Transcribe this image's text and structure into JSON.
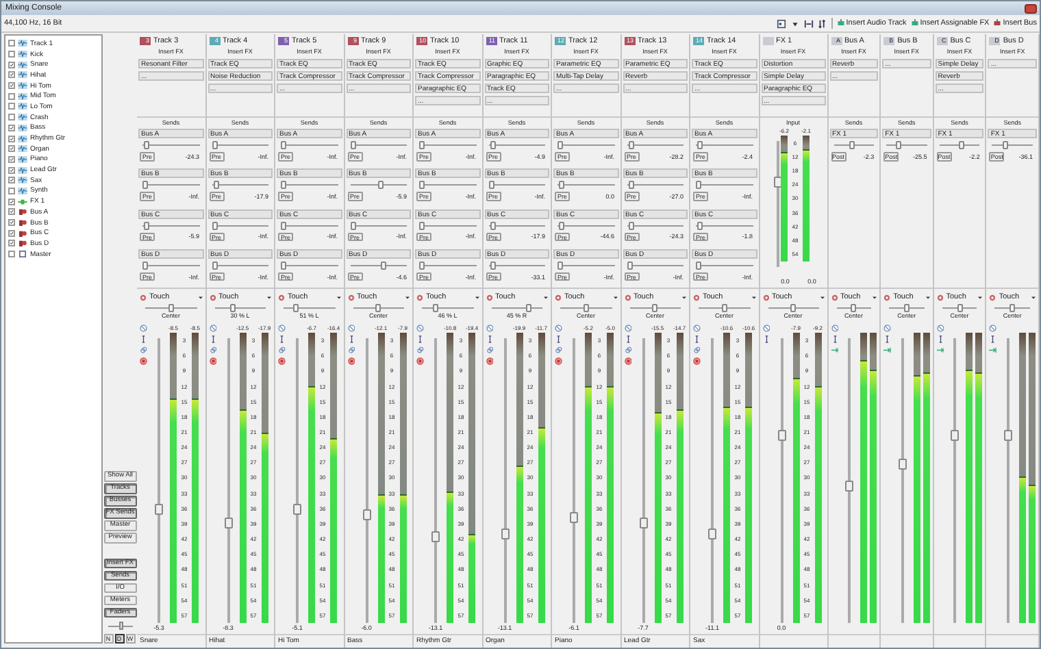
{
  "window": {
    "title": "Mixing Console"
  },
  "format": "44,100 Hz, 16 Bit",
  "toolbar": {
    "buttons": [
      "Insert Audio Track",
      "Insert Assignable FX",
      "Insert Bus"
    ]
  },
  "channel_list": [
    {
      "name": "Track 1",
      "kind": "track",
      "checked": false
    },
    {
      "name": "Kick",
      "kind": "track",
      "checked": false
    },
    {
      "name": "Snare",
      "kind": "track",
      "checked": true
    },
    {
      "name": "Hihat",
      "kind": "track",
      "checked": true
    },
    {
      "name": "Hi Tom",
      "kind": "track",
      "checked": true
    },
    {
      "name": "Mid Tom",
      "kind": "track",
      "checked": false
    },
    {
      "name": "Lo Tom",
      "kind": "track",
      "checked": false
    },
    {
      "name": "Crash",
      "kind": "track",
      "checked": false
    },
    {
      "name": "Bass",
      "kind": "track",
      "checked": true
    },
    {
      "name": "Rhythm Gtr",
      "kind": "track",
      "checked": true
    },
    {
      "name": "Organ",
      "kind": "track",
      "checked": true
    },
    {
      "name": "Piano",
      "kind": "track",
      "checked": true
    },
    {
      "name": "Lead Gtr",
      "kind": "track",
      "checked": true
    },
    {
      "name": "Sax",
      "kind": "track",
      "checked": true
    },
    {
      "name": "Synth",
      "kind": "track",
      "checked": false
    },
    {
      "name": "FX 1",
      "kind": "fx",
      "checked": true
    },
    {
      "name": "Bus A",
      "kind": "bus",
      "checked": true
    },
    {
      "name": "Bus B",
      "kind": "bus",
      "checked": true
    },
    {
      "name": "Bus C",
      "kind": "bus",
      "checked": true
    },
    {
      "name": "Bus D",
      "kind": "bus",
      "checked": true
    },
    {
      "name": "Master",
      "kind": "master",
      "checked": false
    }
  ],
  "view_buttons": [
    {
      "label": "Show All",
      "checked": false
    },
    {
      "label": "Tracks",
      "checked": true
    },
    {
      "label": "Busses",
      "checked": true
    },
    {
      "label": "FX Sends",
      "checked": true
    },
    {
      "label": "Master",
      "checked": false
    },
    {
      "label": "Preview",
      "checked": false
    }
  ],
  "section_buttons": [
    {
      "label": "Insert FX",
      "checked": true
    },
    {
      "label": "Sends",
      "checked": true
    },
    {
      "label": "I/O",
      "checked": false
    },
    {
      "label": "Meters",
      "checked": false
    },
    {
      "label": "Faders",
      "checked": true
    }
  ],
  "width_slider": {
    "level": 0.55
  },
  "mode_buttons": [
    {
      "label": "N",
      "selected": false
    },
    {
      "label": "D",
      "selected": true
    },
    {
      "label": "W",
      "selected": false
    }
  ],
  "strips": [
    {
      "kind": "track",
      "badge": "3",
      "color": "#b0505e",
      "name": "Track 3",
      "insert_label": "Insert FX",
      "inserts": [
        "Resonant Filter",
        "..."
      ],
      "sends_label": "Sends",
      "sends": [
        {
          "bus": "Bus A",
          "level": 0.03,
          "mode": "Pre",
          "reading": "-24.3"
        },
        {
          "bus": "Bus B",
          "level": 0,
          "mode": "Pre",
          "reading": "-Inf."
        },
        {
          "bus": "Bus C",
          "level": 0.03,
          "mode": "Pre",
          "reading": "-5.9"
        },
        {
          "bus": "Bus D",
          "level": 0,
          "mode": "Pre",
          "reading": "-Inf."
        }
      ],
      "automation": "Touch",
      "pan": {
        "level": 0.5,
        "label": "Center"
      },
      "peaks": [
        "-8.5",
        "-8.5"
      ],
      "meters": [
        {
          "level": 0.77
        },
        {
          "level": 0.77
        }
      ],
      "scale": [
        "3",
        "6",
        "9",
        "12",
        "15",
        "18",
        "21",
        "24",
        "27",
        "30",
        "33",
        "36",
        "39",
        "42",
        "45",
        "48",
        "51",
        "54",
        "57"
      ],
      "fader": {
        "level": 0.4,
        "reading": "-5.3"
      },
      "footer": "Snare"
    },
    {
      "kind": "track",
      "badge": "4",
      "color": "#5eaab6",
      "name": "Track 4",
      "insert_label": "Insert FX",
      "inserts": [
        "Track EQ",
        "Noise Reduction",
        "..."
      ],
      "sends_label": "Sends",
      "sends": [
        {
          "bus": "Bus A",
          "level": 0,
          "mode": "Pre",
          "reading": "-Inf."
        },
        {
          "bus": "Bus B",
          "level": 0.03,
          "mode": "Pre",
          "reading": "-17.9"
        },
        {
          "bus": "Bus C",
          "level": 0,
          "mode": "Pre",
          "reading": "-Inf."
        },
        {
          "bus": "Bus D",
          "level": 0,
          "mode": "Pre",
          "reading": "-Inf."
        }
      ],
      "automation": "Touch",
      "pan": {
        "level": 0.35,
        "label": "30 % L"
      },
      "peaks": [
        "-12.5",
        "-17.9"
      ],
      "meters": [
        {
          "level": 0.73
        },
        {
          "level": 0.65
        }
      ],
      "scale": [
        "3",
        "6",
        "9",
        "12",
        "15",
        "18",
        "21",
        "24",
        "27",
        "30",
        "33",
        "36",
        "39",
        "42",
        "45",
        "48",
        "51",
        "54",
        "57"
      ],
      "fader": {
        "level": 0.35,
        "reading": "-8.3"
      },
      "footer": "Hihat"
    },
    {
      "kind": "track",
      "badge": "5",
      "color": "#7f60b0",
      "name": "Track 5",
      "insert_label": "Insert FX",
      "inserts": [
        "Track EQ",
        "Track Compressor",
        "..."
      ],
      "sends_label": "Sends",
      "sends": [
        {
          "bus": "Bus A",
          "level": 0,
          "mode": "Pre",
          "reading": "-Inf."
        },
        {
          "bus": "Bus B",
          "level": 0,
          "mode": "Pre",
          "reading": "-Inf."
        },
        {
          "bus": "Bus C",
          "level": 0,
          "mode": "Pre",
          "reading": "-Inf."
        },
        {
          "bus": "Bus D",
          "level": 0,
          "mode": "Pre",
          "reading": "-Inf."
        }
      ],
      "automation": "Touch",
      "pan": {
        "level": 0.25,
        "label": "51 % L"
      },
      "peaks": [
        "-6.7",
        "-16.4"
      ],
      "meters": [
        {
          "level": 0.81
        },
        {
          "level": 0.63
        }
      ],
      "scale": [
        "3",
        "6",
        "9",
        "12",
        "15",
        "18",
        "21",
        "24",
        "27",
        "30",
        "33",
        "36",
        "39",
        "42",
        "45",
        "48",
        "51",
        "54",
        "57"
      ],
      "fader": {
        "level": 0.4,
        "reading": "-5.1"
      },
      "footer": "Hi Tom"
    },
    {
      "kind": "track",
      "badge": "9",
      "color": "#b0505e",
      "name": "Track 9",
      "insert_label": "Insert FX",
      "inserts": [
        "Track EQ",
        "Track Compressor",
        "..."
      ],
      "sends_label": "Sends",
      "sends": [
        {
          "bus": "Bus A",
          "level": 0,
          "mode": "Pre",
          "reading": "-Inf."
        },
        {
          "bus": "Bus B",
          "level": 0.55,
          "mode": "Pre",
          "reading": "-5.9"
        },
        {
          "bus": "Bus C",
          "level": 0,
          "mode": "Pre",
          "reading": "-Inf."
        },
        {
          "bus": "Bus D",
          "level": 0.6,
          "mode": "Pre",
          "reading": "-4.6"
        }
      ],
      "automation": "Touch",
      "pan": {
        "level": 0.5,
        "label": "Center"
      },
      "peaks": [
        "-12.1",
        "-7.9"
      ],
      "meters": [
        {
          "level": 0.44
        },
        {
          "level": 0.44
        }
      ],
      "scale": [
        "3",
        "6",
        "9",
        "12",
        "15",
        "18",
        "21",
        "24",
        "27",
        "30",
        "33",
        "36",
        "39",
        "42",
        "45",
        "48",
        "51",
        "54",
        "57"
      ],
      "fader": {
        "level": 0.38,
        "reading": "-6.0"
      },
      "footer": "Bass"
    },
    {
      "kind": "track",
      "badge": "10",
      "color": "#b0505e",
      "name": "Track 10",
      "insert_label": "Insert FX",
      "inserts": [
        "Track EQ",
        "Track Compressor",
        "Paragraphic EQ",
        "..."
      ],
      "sends_label": "Sends",
      "sends": [
        {
          "bus": "Bus A",
          "level": 0,
          "mode": "Pre",
          "reading": "-Inf."
        },
        {
          "bus": "Bus B",
          "level": 0,
          "mode": "Pre",
          "reading": "-Inf."
        },
        {
          "bus": "Bus C",
          "level": 0,
          "mode": "Pre",
          "reading": "-Inf."
        },
        {
          "bus": "Bus D",
          "level": 0,
          "mode": "Pre",
          "reading": "-Inf."
        }
      ],
      "automation": "Touch",
      "pan": {
        "level": 0.27,
        "label": "46 % L"
      },
      "peaks": [
        "-10.8",
        "-19.4"
      ],
      "meters": [
        {
          "level": 0.45
        },
        {
          "level": 0.3
        }
      ],
      "scale": [
        "3",
        "6",
        "9",
        "12",
        "15",
        "18",
        "21",
        "24",
        "27",
        "30",
        "33",
        "36",
        "39",
        "42",
        "45",
        "48",
        "51",
        "54",
        "57"
      ],
      "fader": {
        "level": 0.3,
        "reading": "-13.1"
      },
      "footer": "Rhythm Gtr"
    },
    {
      "kind": "track",
      "badge": "11",
      "color": "#7f60b0",
      "name": "Track 11",
      "insert_label": "Insert FX",
      "inserts": [
        "Graphic EQ",
        "Paragraphic EQ",
        "Track EQ",
        "..."
      ],
      "sends_label": "Sends",
      "sends": [
        {
          "bus": "Bus A",
          "level": 0.03,
          "mode": "Pre",
          "reading": "-4.9"
        },
        {
          "bus": "Bus B",
          "level": 0,
          "mode": "Pre",
          "reading": "-Inf."
        },
        {
          "bus": "Bus C",
          "level": 0.03,
          "mode": "Pre",
          "reading": "-17.9"
        },
        {
          "bus": "Bus D",
          "level": 0.03,
          "mode": "Pre",
          "reading": "-33.1"
        }
      ],
      "automation": "Touch",
      "pan": {
        "level": 0.72,
        "label": "45 % R"
      },
      "peaks": [
        "-19.9",
        "-11.7"
      ],
      "meters": [
        {
          "level": 0.54
        },
        {
          "level": 0.67
        }
      ],
      "scale": [
        "3",
        "6",
        "9",
        "12",
        "15",
        "18",
        "21",
        "24",
        "27",
        "30",
        "33",
        "36",
        "39",
        "42",
        "45",
        "48",
        "51",
        "54",
        "57"
      ],
      "fader": {
        "level": 0.31,
        "reading": "-13.1"
      },
      "footer": "Organ"
    },
    {
      "kind": "track",
      "badge": "12",
      "color": "#5eaab6",
      "name": "Track 12",
      "insert_label": "Insert FX",
      "inserts": [
        "Parametric EQ",
        "Multi-Tap Delay",
        "..."
      ],
      "sends_label": "Sends",
      "sends": [
        {
          "bus": "Bus A",
          "level": 0,
          "mode": "Pre",
          "reading": "-Inf."
        },
        {
          "bus": "Bus B",
          "level": 0.03,
          "mode": "Pre",
          "reading": "0.0"
        },
        {
          "bus": "Bus C",
          "level": 0.03,
          "mode": "Pre",
          "reading": "-44.6"
        },
        {
          "bus": "Bus D",
          "level": 0,
          "mode": "Pre",
          "reading": "-Inf."
        }
      ],
      "automation": "Touch",
      "pan": {
        "level": 0.5,
        "label": "Center"
      },
      "peaks": [
        "-5.2",
        "-5.0"
      ],
      "meters": [
        {
          "level": 0.81
        },
        {
          "level": 0.81
        }
      ],
      "scale": [
        "3",
        "6",
        "9",
        "12",
        "15",
        "18",
        "21",
        "24",
        "27",
        "30",
        "33",
        "36",
        "39",
        "42",
        "45",
        "48",
        "51",
        "54",
        "57"
      ],
      "fader": {
        "level": 0.37,
        "reading": "-6.1"
      },
      "footer": "Piano"
    },
    {
      "kind": "track",
      "badge": "13",
      "color": "#b0505e",
      "name": "Track 13",
      "insert_label": "Insert FX",
      "inserts": [
        "Parametric EQ",
        "Reverb",
        "..."
      ],
      "sends_label": "Sends",
      "sends": [
        {
          "bus": "Bus A",
          "level": 0.03,
          "mode": "Pre",
          "reading": "-28.2"
        },
        {
          "bus": "Bus B",
          "level": 0.03,
          "mode": "Pre",
          "reading": "-27.0"
        },
        {
          "bus": "Bus C",
          "level": 0.03,
          "mode": "Pre",
          "reading": "-24.3"
        },
        {
          "bus": "Bus D",
          "level": 0,
          "mode": "Pre",
          "reading": "-Inf."
        }
      ],
      "automation": "Touch",
      "pan": {
        "level": 0.5,
        "label": "Center"
      },
      "peaks": [
        "-15.5",
        "-14.7"
      ],
      "meters": [
        {
          "level": 0.72
        },
        {
          "level": 0.73
        }
      ],
      "scale": [
        "3",
        "6",
        "9",
        "12",
        "15",
        "18",
        "21",
        "24",
        "27",
        "30",
        "33",
        "36",
        "39",
        "42",
        "45",
        "48",
        "51",
        "54",
        "57"
      ],
      "fader": {
        "level": 0.35,
        "reading": "-7.7"
      },
      "footer": "Lead Gtr"
    },
    {
      "kind": "track",
      "badge": "14",
      "color": "#5eaab6",
      "name": "Track 14",
      "insert_label": "Insert FX",
      "inserts": [
        "Track EQ",
        "Track Compressor",
        "..."
      ],
      "sends_label": "Sends",
      "sends": [
        {
          "bus": "Bus A",
          "level": 0.03,
          "mode": "Pre",
          "reading": "-2.4"
        },
        {
          "bus": "Bus B",
          "level": 0,
          "mode": "Pre",
          "reading": "-Inf."
        },
        {
          "bus": "Bus C",
          "level": 0.03,
          "mode": "Pre",
          "reading": "-1.8"
        },
        {
          "bus": "Bus D",
          "level": 0,
          "mode": "Pre",
          "reading": "-Inf."
        }
      ],
      "automation": "Touch",
      "pan": {
        "level": 0.5,
        "label": "Center"
      },
      "peaks": [
        "-10.6",
        "-10.6"
      ],
      "meters": [
        {
          "level": 0.74
        },
        {
          "level": 0.74
        }
      ],
      "scale": [
        "3",
        "6",
        "9",
        "12",
        "15",
        "18",
        "21",
        "24",
        "27",
        "30",
        "33",
        "36",
        "39",
        "42",
        "45",
        "48",
        "51",
        "54",
        "57"
      ],
      "fader": {
        "level": 0.31,
        "reading": "-11.1"
      },
      "footer": "Sax"
    },
    {
      "kind": "fx",
      "name": "FX 1",
      "insert_label": "Insert FX",
      "inserts": [
        "Distortion",
        "Simple Delay",
        "Paragraphic EQ",
        "..."
      ],
      "input": {
        "label": "Input",
        "peaks": [
          "-6.2",
          "-2.1"
        ],
        "meters": [
          {
            "level": 0.86
          },
          {
            "level": 0.88
          }
        ],
        "scale": [
          "6",
          "12",
          "18",
          "24",
          "30",
          "36",
          "42",
          "48",
          "54"
        ],
        "readings": [
          "0.0",
          "0.0"
        ],
        "fader": {
          "level": 0.68
        }
      },
      "automation": "Touch",
      "pan": {
        "level": 0.5,
        "label": "Center"
      },
      "peaks": [
        "-7.9",
        "-9.2"
      ],
      "meters": [
        {
          "level": 0.84
        },
        {
          "level": 0.81
        }
      ],
      "scale": [
        "3",
        "6",
        "9",
        "12",
        "15",
        "18",
        "21",
        "24",
        "27",
        "30",
        "33",
        "36",
        "39",
        "42",
        "45",
        "48",
        "51",
        "54",
        "57"
      ],
      "fader": {
        "level": 0.66,
        "reading": "0.0"
      }
    },
    {
      "kind": "bus",
      "badge": "A",
      "name": "Bus A",
      "insert_label": "Insert FX",
      "inserts": [
        "Reverb",
        "..."
      ],
      "sends_label": "Sends",
      "sends": [
        {
          "bus": "FX 1",
          "level": 0.45,
          "mode": "Post",
          "reading": "-2.3"
        }
      ],
      "automation": "Touch",
      "pan": {
        "level": 0.5,
        "label": "Center"
      },
      "meters": [
        {
          "level": 0.9
        },
        {
          "level": 0.87
        }
      ],
      "fader": {
        "level": 0.48
      }
    },
    {
      "kind": "bus",
      "badge": "B",
      "name": "Bus B",
      "insert_label": "Insert FX",
      "inserts": [
        "..."
      ],
      "sends_label": "Sends",
      "sends": [
        {
          "bus": "FX 1",
          "level": 0.25,
          "mode": "Post",
          "reading": "-25.5"
        }
      ],
      "automation": "Touch",
      "pan": {
        "level": 0.5,
        "label": "Center"
      },
      "meters": [
        {
          "level": 0.85
        },
        {
          "level": 0.86
        }
      ],
      "fader": {
        "level": 0.56
      }
    },
    {
      "kind": "bus",
      "badge": "C",
      "name": "Bus C",
      "insert_label": "Insert FX",
      "inserts": [
        "Simple Delay",
        "Reverb",
        "..."
      ],
      "sends_label": "Sends",
      "sends": [
        {
          "bus": "FX 1",
          "level": 0.55,
          "mode": "Post",
          "reading": "-2.2"
        }
      ],
      "automation": "Touch",
      "pan": {
        "level": 0.5,
        "label": "Center"
      },
      "meters": [
        {
          "level": 0.87
        },
        {
          "level": 0.86
        }
      ],
      "fader": {
        "level": 0.66
      }
    },
    {
      "kind": "bus",
      "badge": "D",
      "name": "Bus D",
      "insert_label": "Insert FX",
      "inserts": [
        "..."
      ],
      "sends_label": "Sends",
      "sends": [
        {
          "bus": "FX 1",
          "level": 0.3,
          "mode": "Post",
          "reading": "-36.1"
        }
      ],
      "automation": "Touch",
      "pan": {
        "level": 0.5,
        "label": "Center"
      },
      "meters": [
        {
          "level": 0.5
        },
        {
          "level": 0.47
        }
      ],
      "fader": {
        "level": 0.66
      }
    }
  ]
}
